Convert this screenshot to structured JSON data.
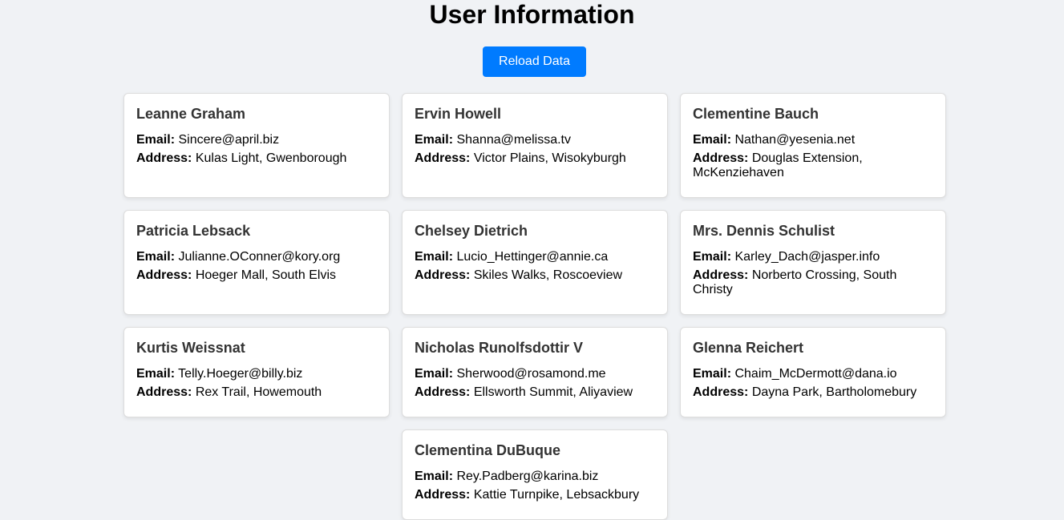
{
  "page": {
    "title": "User Information",
    "reload_label": "Reload Data",
    "email_label": "Email:",
    "address_label": "Address:"
  },
  "users": [
    {
      "name": "Leanne Graham",
      "email": "Sincere@april.biz",
      "address": "Kulas Light, Gwenborough"
    },
    {
      "name": "Ervin Howell",
      "email": "Shanna@melissa.tv",
      "address": "Victor Plains, Wisokyburgh"
    },
    {
      "name": "Clementine Bauch",
      "email": "Nathan@yesenia.net",
      "address": "Douglas Extension, McKenziehaven"
    },
    {
      "name": "Patricia Lebsack",
      "email": "Julianne.OConner@kory.org",
      "address": "Hoeger Mall, South Elvis"
    },
    {
      "name": "Chelsey Dietrich",
      "email": "Lucio_Hettinger@annie.ca",
      "address": "Skiles Walks, Roscoeview"
    },
    {
      "name": "Mrs. Dennis Schulist",
      "email": "Karley_Dach@jasper.info",
      "address": "Norberto Crossing, South Christy"
    },
    {
      "name": "Kurtis Weissnat",
      "email": "Telly.Hoeger@billy.biz",
      "address": "Rex Trail, Howemouth"
    },
    {
      "name": "Nicholas Runolfsdottir V",
      "email": "Sherwood@rosamond.me",
      "address": "Ellsworth Summit, Aliyaview"
    },
    {
      "name": "Glenna Reichert",
      "email": "Chaim_McDermott@dana.io",
      "address": "Dayna Park, Bartholomebury"
    },
    {
      "name": "Clementina DuBuque",
      "email": "Rey.Padberg@karina.biz",
      "address": "Kattie Turnpike, Lebsackbury"
    }
  ]
}
